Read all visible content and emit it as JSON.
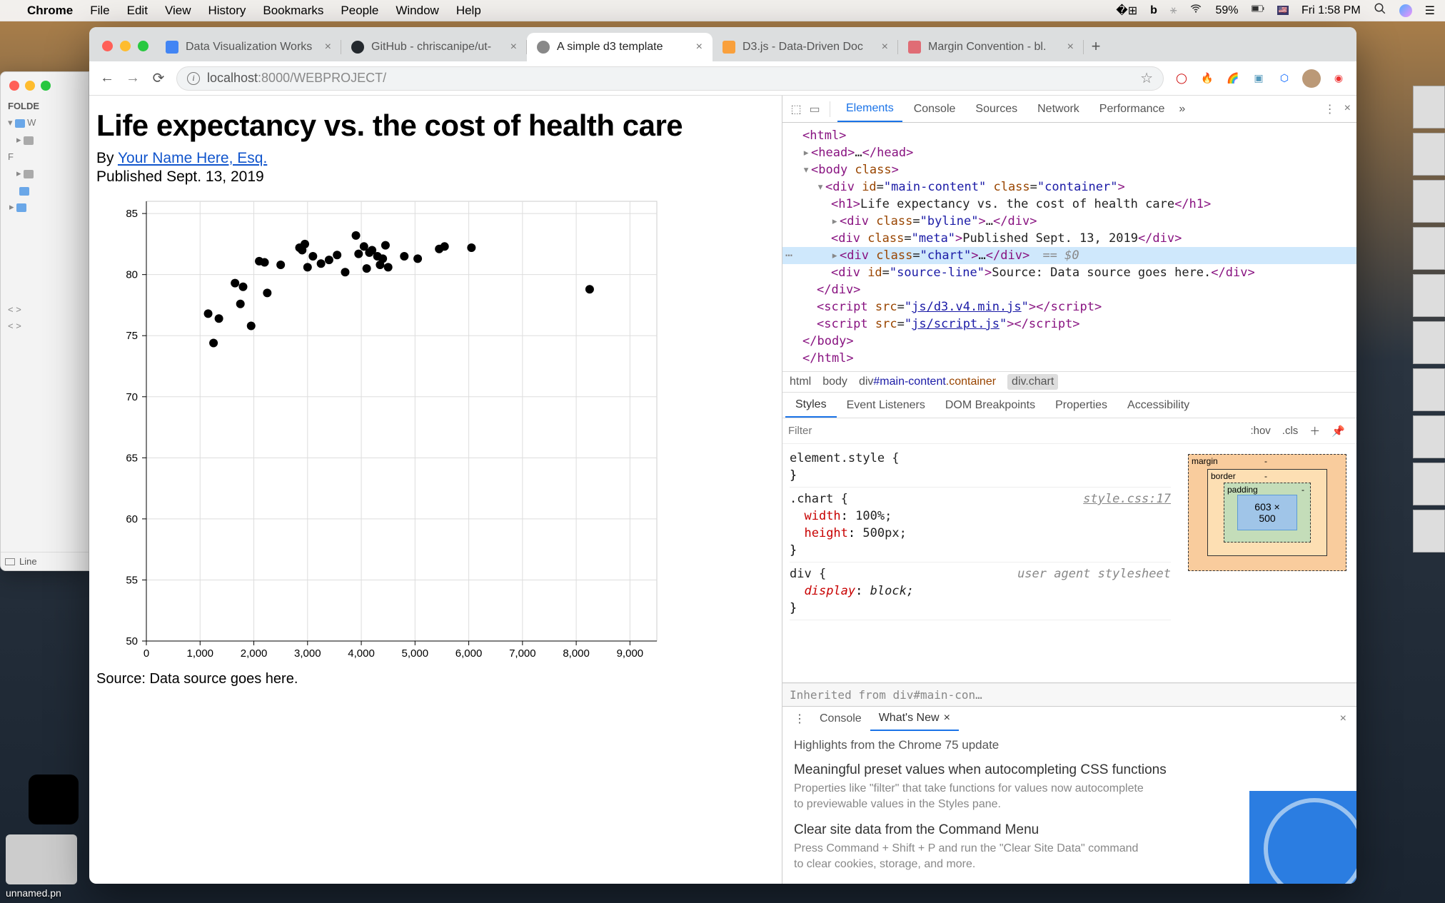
{
  "menubar": {
    "app": "Chrome",
    "items": [
      "File",
      "Edit",
      "View",
      "History",
      "Bookmarks",
      "People",
      "Window",
      "Help"
    ],
    "battery": "59%",
    "clock": "Fri 1:58 PM"
  },
  "finder": {
    "title": "FOLDE",
    "lines": [
      "W",
      "F",
      "Line"
    ],
    "bracket1": "< >",
    "bracket2": "< >"
  },
  "tabs": [
    {
      "title": "Data Visualization Works",
      "favicon": "#4285f4"
    },
    {
      "title": "GitHub - chriscanipe/ut-",
      "favicon": "#24292e"
    },
    {
      "title": "A simple d3 template",
      "favicon": "#777",
      "active": true
    },
    {
      "title": "D3.js - Data-Driven Doc",
      "favicon": "#f9a03c"
    },
    {
      "title": "Margin Convention - bl.",
      "favicon": "#e06c75"
    }
  ],
  "url": {
    "host": "localhost",
    "port": ":8000",
    "path": "/WEBPROJECT/"
  },
  "page": {
    "title": "Life expectancy vs. the cost of health care",
    "by_prefix": "By ",
    "author": "Your Name Here, Esq.",
    "published": "Published Sept. 13, 2019",
    "source": "Source: Data source goes here."
  },
  "chart_data": {
    "type": "scatter",
    "xlabel": "",
    "ylabel": "",
    "xlim": [
      0,
      9500
    ],
    "ylim": [
      50,
      86
    ],
    "xticks": [
      0,
      1000,
      2000,
      3000,
      4000,
      5000,
      6000,
      7000,
      8000,
      9000
    ],
    "yticks": [
      50,
      55,
      60,
      65,
      70,
      75,
      80,
      85
    ],
    "xtick_labels": [
      "0",
      "1,000",
      "2,000",
      "3,000",
      "4,000",
      "5,000",
      "6,000",
      "7,000",
      "8,000",
      "9,000"
    ],
    "points": [
      {
        "x": 1150,
        "y": 76.8
      },
      {
        "x": 1250,
        "y": 74.4
      },
      {
        "x": 1350,
        "y": 76.4
      },
      {
        "x": 1650,
        "y": 79.3
      },
      {
        "x": 1750,
        "y": 77.6
      },
      {
        "x": 1800,
        "y": 79.0
      },
      {
        "x": 1950,
        "y": 75.8
      },
      {
        "x": 2100,
        "y": 81.1
      },
      {
        "x": 2200,
        "y": 81.0
      },
      {
        "x": 2250,
        "y": 78.5
      },
      {
        "x": 2500,
        "y": 80.8
      },
      {
        "x": 2850,
        "y": 82.2
      },
      {
        "x": 2900,
        "y": 82.0
      },
      {
        "x": 2950,
        "y": 82.5
      },
      {
        "x": 3000,
        "y": 80.6
      },
      {
        "x": 3100,
        "y": 81.5
      },
      {
        "x": 3250,
        "y": 80.9
      },
      {
        "x": 3400,
        "y": 81.2
      },
      {
        "x": 3550,
        "y": 81.6
      },
      {
        "x": 3700,
        "y": 80.2
      },
      {
        "x": 3900,
        "y": 83.2
      },
      {
        "x": 3950,
        "y": 81.7
      },
      {
        "x": 4050,
        "y": 82.3
      },
      {
        "x": 4100,
        "y": 80.5
      },
      {
        "x": 4150,
        "y": 81.8
      },
      {
        "x": 4200,
        "y": 82.0
      },
      {
        "x": 4300,
        "y": 81.5
      },
      {
        "x": 4350,
        "y": 80.8
      },
      {
        "x": 4400,
        "y": 81.3
      },
      {
        "x": 4450,
        "y": 82.4
      },
      {
        "x": 4500,
        "y": 80.6
      },
      {
        "x": 4800,
        "y": 81.5
      },
      {
        "x": 5050,
        "y": 81.3
      },
      {
        "x": 5450,
        "y": 82.1
      },
      {
        "x": 5550,
        "y": 82.3
      },
      {
        "x": 6050,
        "y": 82.2
      },
      {
        "x": 8250,
        "y": 78.8
      }
    ]
  },
  "devtools": {
    "tabs": [
      "Elements",
      "Console",
      "Sources",
      "Network",
      "Performance"
    ],
    "dom": {
      "h1_text": "Life expectancy vs. the cost of health care",
      "meta_text": "Published Sept. 13, 2019",
      "source_text": "Source: Data source goes here.",
      "d3_src": "js/d3.v4.min.js",
      "script_src": "js/script.js",
      "selected_after": " == $0"
    },
    "crumbs": [
      "html",
      "body"
    ],
    "crumb_main": "div#main-content.container",
    "crumb_sel": "div.chart",
    "subtabs": [
      "Styles",
      "Event Listeners",
      "DOM Breakpoints",
      "Properties",
      "Accessibility"
    ],
    "filter_placeholder": "Filter",
    "hov": ":hov",
    "cls": ".cls",
    "styles": {
      "element": "element.style {",
      "chart_sel": ".chart {",
      "chart_link": "style.css:17",
      "width_p": "width",
      "width_v": "100%;",
      "height_p": "height",
      "height_v": "500px;",
      "div_sel": "div {",
      "ua": "user agent stylesheet",
      "display_p": "display",
      "display_v": "block;",
      "inherited": "Inherited from ",
      "inherited_el": "div#main-con…"
    },
    "boxmodel": {
      "margin": "margin",
      "border": "border",
      "padding": "padding",
      "content": "603 × 500",
      "dash": "-"
    },
    "drawer": {
      "tabs": [
        "Console",
        "What's New"
      ],
      "headline": "Highlights from the Chrome 75 update",
      "h1": "Meaningful preset values when autocompleting CSS functions",
      "p1": "Properties like \"filter\" that take functions for values now autocomplete to previewable values in the Styles pane.",
      "h2": "Clear site data from the Command Menu",
      "p2": "Press Command + Shift + P and run the \"Clear Site Data\" command to clear cookies, storage, and more."
    }
  },
  "dock": {
    "unnamed": "unnamed.pn"
  }
}
